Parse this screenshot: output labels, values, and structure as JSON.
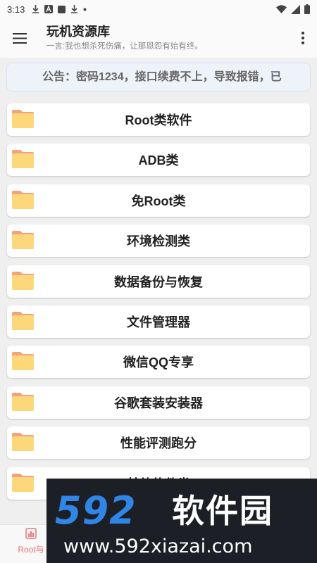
{
  "status_bar": {
    "time": "3:13"
  },
  "app_bar": {
    "title": "玩机资源库",
    "subtitle": "一言:我也想杀死伤痛，让那恩怨有始有终。",
    "menu_icon": "hamburger-menu-icon",
    "more_icon": "more-vertical-icon"
  },
  "notice": {
    "text": "公告：密码1234，接口续费不上，导致报错，已"
  },
  "categories": [
    {
      "label": "Root类软件"
    },
    {
      "label": "ADB类"
    },
    {
      "label": "免Root类"
    },
    {
      "label": "环境检测类"
    },
    {
      "label": "数据备份与恢复"
    },
    {
      "label": "文件管理器"
    },
    {
      "label": "微信QQ专享"
    },
    {
      "label": "谷歌套装安装器"
    },
    {
      "label": "性能评测跑分"
    },
    {
      "label": "其他软件类"
    }
  ],
  "bottom_nav": {
    "tab_label": "Root与",
    "accent": "#e8707a"
  },
  "watermark": {
    "logo_number": "592",
    "logo_text": "软件园",
    "url": "www.592xiazai.com"
  },
  "colors": {
    "folder": "#fcd87a",
    "folder_tab": "#f5a27c",
    "watermark_bg": "#1c1f26",
    "watermark_blue": "#2f86e6"
  }
}
